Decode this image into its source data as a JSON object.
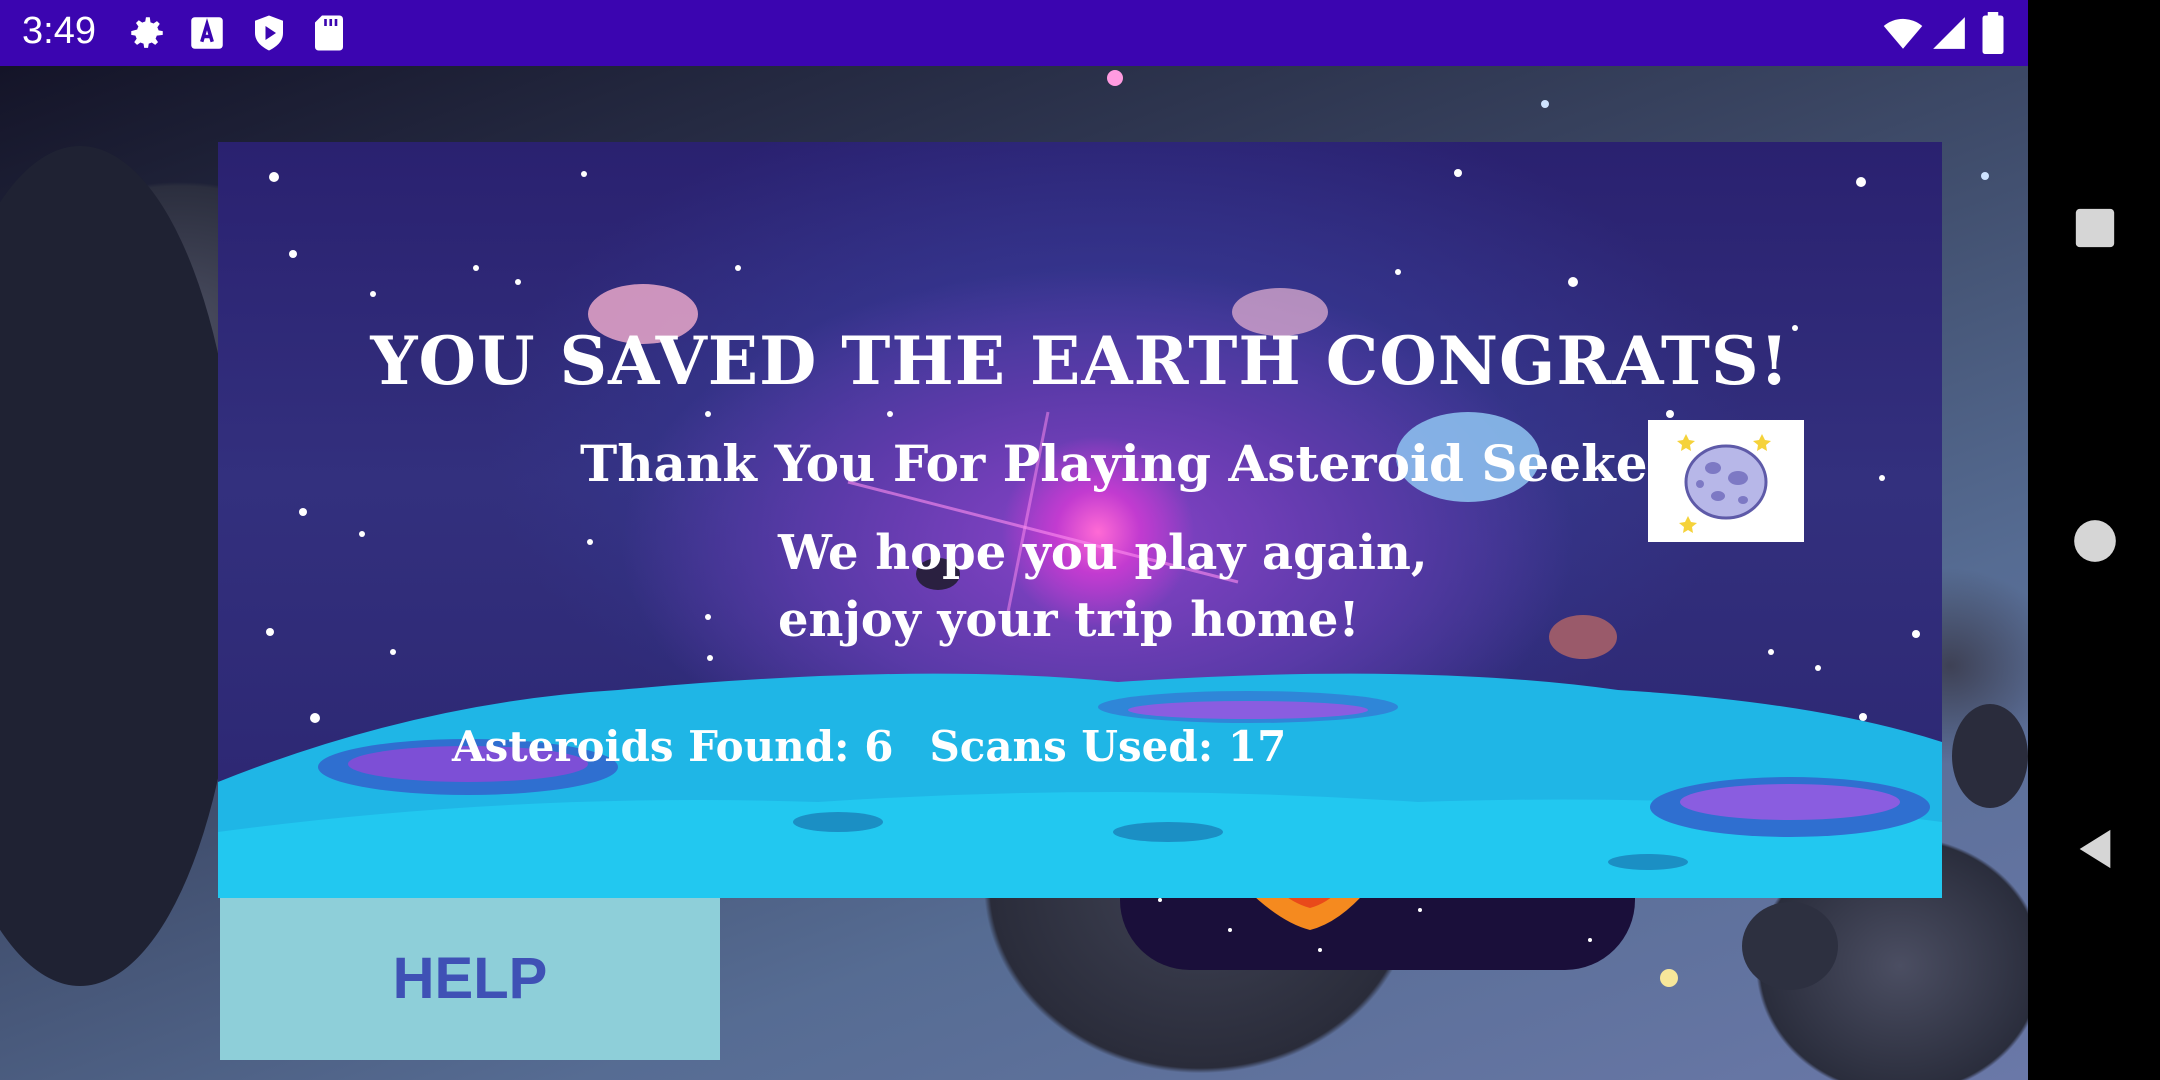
{
  "status_bar": {
    "time": "3:49",
    "icons": [
      "gear-icon",
      "font-a-icon",
      "play-store-icon",
      "sd-card-icon"
    ],
    "right_icons": [
      "wifi-icon",
      "signal-icon",
      "battery-icon"
    ],
    "background_color": "#3b05b0"
  },
  "dialog": {
    "title": "YOU SAVED THE EARTH CONGRATS!",
    "subtitle": "Thank You For Playing Asteroid Seeker",
    "message_line1": "We hope you play again,",
    "message_line2": "enjoy your trip home!",
    "stats": {
      "asteroids_label": "Asteroids Found:",
      "asteroids_value": "6",
      "scans_label": "Scans Used:",
      "scans_value": "17"
    },
    "badge_icon": "asteroid-icon"
  },
  "buttons": {
    "help_label": "HELP",
    "help_color": "#8ecfd9",
    "help_text_color": "#3f51b5"
  },
  "nav_bar": {
    "icons": [
      "recents-icon",
      "home-icon",
      "back-icon"
    ]
  }
}
